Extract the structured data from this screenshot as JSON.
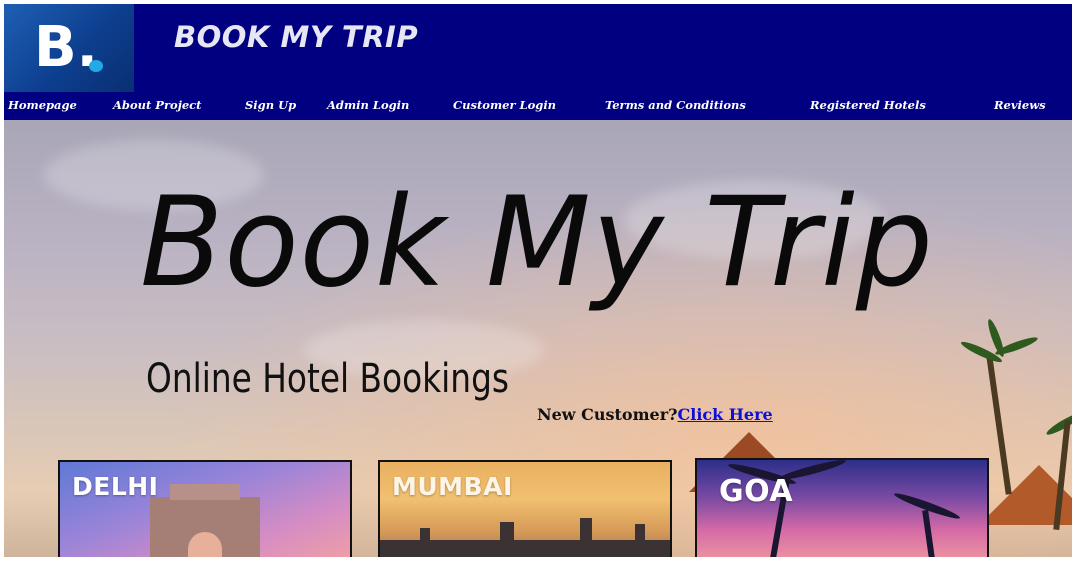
{
  "header": {
    "logo_letter": "B.",
    "site_title": "BOOK MY TRIP",
    "brand_color": "#000080",
    "logo_accent": "#24a9e8"
  },
  "nav": {
    "items": [
      {
        "label": "Homepage"
      },
      {
        "label": "About Project"
      },
      {
        "label": "Sign Up"
      },
      {
        "label": "Admin Login"
      },
      {
        "label": "Customer Login"
      },
      {
        "label": "Terms and Conditions"
      },
      {
        "label": "Registered Hotels"
      },
      {
        "label": "Reviews"
      }
    ]
  },
  "hero": {
    "title": "Book My Trip",
    "subtitle": "Online Hotel Bookings",
    "new_customer_text": "New Customer?",
    "new_customer_link": "Click Here"
  },
  "destinations": [
    {
      "label": "DELHI"
    },
    {
      "label": "MUMBAI"
    },
    {
      "label": "GOA"
    }
  ]
}
